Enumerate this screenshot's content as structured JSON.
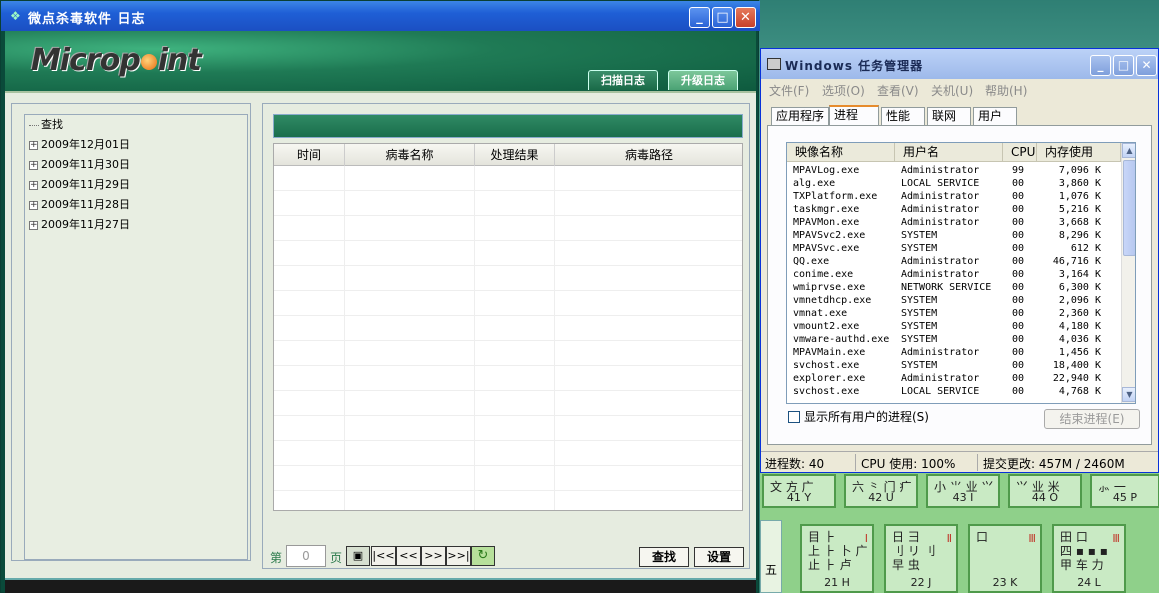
{
  "mp": {
    "title": "微点杀毒软件  日志",
    "logo": {
      "pre": "Microp",
      "post": "int"
    },
    "tabs": [
      "扫描日志",
      "升级日志"
    ],
    "tree": {
      "root": "查找",
      "items": [
        "2009年12月01日",
        "2009年11月30日",
        "2009年11月29日",
        "2009年11月28日",
        "2009年11月27日"
      ]
    },
    "columns": [
      "时间",
      "病毒名称",
      "处理结果",
      "病毒路径"
    ],
    "pager": {
      "prefix": "第",
      "value": "0",
      "suffix": "页",
      "first": "|<<",
      "prev": "<<",
      "next": ">>",
      "last": ">>|"
    },
    "buttons": {
      "find": "查找",
      "settings": "设置"
    }
  },
  "tm": {
    "title": "Windows 任务管理器",
    "menu": [
      "文件(F)",
      "选项(O)",
      "查看(V)",
      "关机(U)",
      "帮助(H)"
    ],
    "tabs": [
      "应用程序",
      "进程",
      "性能",
      "联网",
      "用户"
    ],
    "columns": [
      "映像名称",
      "用户名",
      "CPU",
      "内存使用"
    ],
    "rows": [
      [
        "MPAVLog.exe",
        "Administrator",
        "99",
        "7,096 K"
      ],
      [
        "alg.exe",
        "LOCAL SERVICE",
        "00",
        "3,860 K"
      ],
      [
        "TXPlatform.exe",
        "Administrator",
        "00",
        "1,076 K"
      ],
      [
        "taskmgr.exe",
        "Administrator",
        "00",
        "5,216 K"
      ],
      [
        "MPAVMon.exe",
        "Administrator",
        "00",
        "3,668 K"
      ],
      [
        "MPAVSvc2.exe",
        "SYSTEM",
        "00",
        "8,296 K"
      ],
      [
        "MPAVSvc.exe",
        "SYSTEM",
        "00",
        "612 K"
      ],
      [
        "QQ.exe",
        "Administrator",
        "00",
        "46,716 K"
      ],
      [
        "conime.exe",
        "Administrator",
        "00",
        "3,164 K"
      ],
      [
        "wmiprvse.exe",
        "NETWORK SERVICE",
        "00",
        "6,300 K"
      ],
      [
        "vmnetdhcp.exe",
        "SYSTEM",
        "00",
        "2,096 K"
      ],
      [
        "vmnat.exe",
        "SYSTEM",
        "00",
        "2,360 K"
      ],
      [
        "vmount2.exe",
        "SYSTEM",
        "00",
        "4,180 K"
      ],
      [
        "vmware-authd.exe",
        "SYSTEM",
        "00",
        "4,036 K"
      ],
      [
        "MPAVMain.exe",
        "Administrator",
        "00",
        "1,456 K"
      ],
      [
        "svchost.exe",
        "SYSTEM",
        "00",
        "18,400 K"
      ],
      [
        "explorer.exe",
        "Administrator",
        "00",
        "22,940 K"
      ],
      [
        "svchost.exe",
        "LOCAL SERVICE",
        "00",
        "4,768 K"
      ]
    ],
    "show_all": "显示所有用户的进程(S)",
    "end_process": "结束进程(E)",
    "status": {
      "processes": "进程数: 40",
      "cpu": "CPU 使用: 100%",
      "commit": "提交更改: 457M / 2460M"
    }
  },
  "keyboard": {
    "top_keys": [
      {
        "glyphs": "文 方 广",
        "label": "41 Y"
      },
      {
        "glyphs": "六 ⺀ 门 疒",
        "label": "42 U"
      },
      {
        "glyphs": "小 ⺌ 业 ⺍",
        "label": "43 I"
      },
      {
        "glyphs": "⺍ 业 米",
        "label": "44 O"
      },
      {
        "glyphs": "⺗ 一",
        "label": "45 P"
      }
    ],
    "bottom_keys": [
      {
        "glyphs": "目 ⺊\n上 ⺊ 卜 广\n止 ⺊ 卢",
        "label": "21 H",
        "bars": "Ⅰ"
      },
      {
        "glyphs": "日 ⺕\n刂 リ 刂\n早 虫",
        "label": "22 J",
        "bars": "Ⅱ"
      },
      {
        "glyphs": "口",
        "label": "23 K",
        "bars": "Ⅲ"
      },
      {
        "glyphs": "田 口\n四 ▪ ▪ ▪\n甲 车 力",
        "label": "24 L",
        "bars": "Ⅲ"
      }
    ],
    "side_glyph": "五"
  }
}
